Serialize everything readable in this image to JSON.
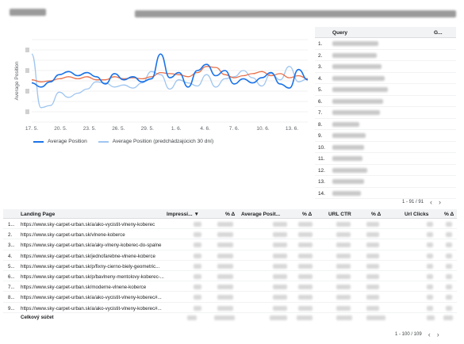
{
  "header": {
    "title": ""
  },
  "chart_data": {
    "type": "line",
    "x": [
      "17. 5.",
      "20. 5.",
      "23. 5.",
      "26. 5.",
      "29. 5.",
      "1. 6.",
      "4. 6.",
      "7. 6.",
      "10. 6.",
      "13. 6."
    ],
    "ylabel": "Average Position",
    "y_inverted": true,
    "grid": true,
    "legend_position": "bottom-left",
    "series": [
      {
        "name": "Average Position",
        "color": "#1a73e8",
        "values": [
          6.2,
          6.6,
          6.1,
          5.4,
          5.1,
          5.5,
          5.2,
          5.6,
          6.3,
          5.3,
          5.9,
          5.6,
          6.1,
          5.8,
          3.4,
          5.7,
          5.2,
          6.6,
          5.0,
          4.4,
          5.5,
          5.0,
          6.3,
          5.8,
          6.2,
          5.7,
          5.2,
          6.3,
          6.7,
          4.9,
          5.9
        ]
      },
      {
        "name": "Average Position (predchádzajúcich 30 dní)",
        "color": "#9fc5f0",
        "values": [
          3.4,
          8.6,
          8.4,
          7.1,
          7.6,
          7.2,
          6.8,
          6.1,
          6.2,
          6.6,
          6.4,
          6.7,
          6.2,
          5.1,
          5.4,
          6.8,
          5.9,
          6.2,
          6.5,
          5.4,
          6.6,
          5.8,
          5.6,
          5.0,
          5.7,
          6.5,
          5.3,
          5.9,
          4.6,
          6.1,
          5.8
        ]
      },
      {
        "name": "",
        "color": "#e8714a",
        "values": [
          5.9,
          6.1,
          6.0,
          5.8,
          5.6,
          5.8,
          5.6,
          5.9,
          5.9,
          5.6,
          5.8,
          5.7,
          5.8,
          5.6,
          5.2,
          5.3,
          5.4,
          5.6,
          5.2,
          4.6,
          4.7,
          5.4,
          5.7,
          5.5,
          5.3,
          5.1,
          5.5,
          5.3,
          5.7,
          5.5,
          5.8
        ]
      }
    ]
  },
  "query_table": {
    "col_query": "Query",
    "col_metric": "G...",
    "rows": [
      "1.",
      "2.",
      "3.",
      "4.",
      "5.",
      "6.",
      "7.",
      "8.",
      "9.",
      "10.",
      "11.",
      "12.",
      "13.",
      "14."
    ],
    "pager_text": "1 - 91 / 91",
    "prev_icon": "chevron-left-icon",
    "next_icon": "chevron-right-icon"
  },
  "landing_table": {
    "headers": {
      "landing_page": "Landing Page",
      "impressions": "Impressi... ▼",
      "delta1": "% Δ",
      "avg_position": "Average Posit...",
      "delta2": "% Δ",
      "url_ctr": "URL CTR",
      "delta3": "% Δ",
      "url_clicks": "Url Clicks",
      "delta4": "% Δ"
    },
    "rows": [
      {
        "num": "1...",
        "url": "https://www.sky-carpet-urban.sk/a/ako-vycistit-vlneny-koberec"
      },
      {
        "num": "2.",
        "url": "https://www.sky-carpet-urban.sk/vlnene-koberce"
      },
      {
        "num": "3...",
        "url": "https://www.sky-carpet-urban.sk/a/aky-vlneny-koberec-do-spalne"
      },
      {
        "num": "4.",
        "url": "https://www.sky-carpet-urban.sk/jednofarebne-vlnene-koberce"
      },
      {
        "num": "5...",
        "url": "https://www.sky-carpet-urban.sk/p/fixny-cierno-biely-geometric..."
      },
      {
        "num": "6...",
        "url": "https://www.sky-carpet-urban.sk/p/bavlneny-mentolovy-koberec-..."
      },
      {
        "num": "7...",
        "url": "https://www.sky-carpet-urban.sk/moderne-vlnene-koberce"
      },
      {
        "num": "8...",
        "url": "https://www.sky-carpet-urban.sk/a/ako-vycistit-vlneny-koberec#..."
      },
      {
        "num": "9...",
        "url": "https://www.sky-carpet-urban.sk/a/ako-vycistit-vlneny-koberec#..."
      }
    ],
    "total_label": "Celkový súčet",
    "pager_text": "1 - 100 / 109"
  }
}
